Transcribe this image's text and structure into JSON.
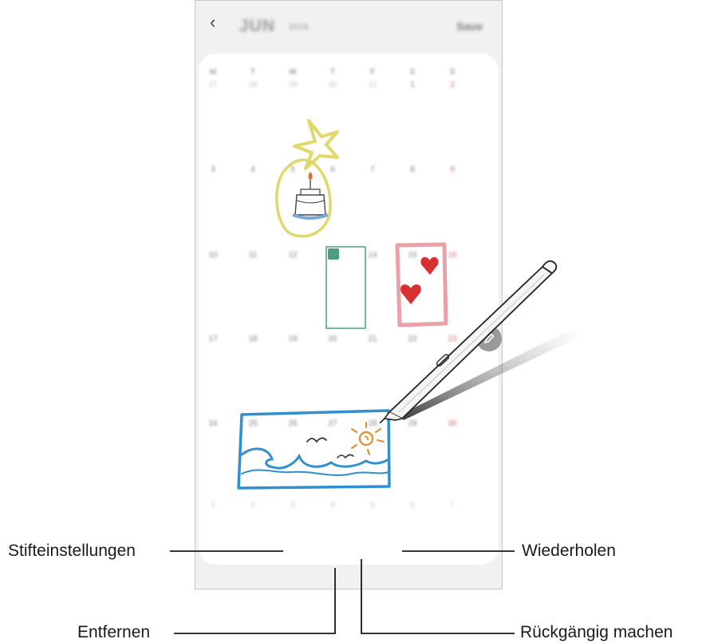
{
  "header": {
    "back_icon": "chevron-left-icon",
    "month": "JUN",
    "year": "2019",
    "save_label": "Save"
  },
  "calendar": {
    "weekdays": [
      "M",
      "T",
      "W",
      "T",
      "F",
      "S",
      "S"
    ],
    "weeks": [
      [
        "27",
        "28",
        "29",
        "30",
        "31",
        "1",
        "2"
      ],
      [
        "3",
        "4",
        "5",
        "6",
        "7",
        "8",
        "9"
      ],
      [
        "10",
        "11",
        "12",
        "13",
        "14",
        "15",
        "16"
      ],
      [
        "17",
        "18",
        "19",
        "20",
        "21",
        "22",
        "23"
      ],
      [
        "24",
        "25",
        "26",
        "27",
        "28",
        "29",
        "30"
      ],
      [
        "1",
        "2",
        "3",
        "4",
        "5",
        "6",
        "7"
      ]
    ]
  },
  "toolbar": {
    "pen_settings_icon": "pen-icon",
    "eraser_icon": "eraser-icon",
    "undo_icon": "undo-icon",
    "redo_icon": "redo-icon"
  },
  "fab_icon": "pencil-icon",
  "callouts": {
    "pen_settings": "Stifteinstellungen",
    "eraser": "Entfernen",
    "redo": "Wiederholen",
    "undo": "Rückgängig machen"
  },
  "colors": {
    "sunday": "#d06868",
    "accent_callout": "#1a1a1a",
    "drawing_blue": "#2f8fcf",
    "drawing_yellow": "#e0d86a",
    "drawing_green": "#4aa07c",
    "drawing_pink": "#e9a0a6"
  }
}
